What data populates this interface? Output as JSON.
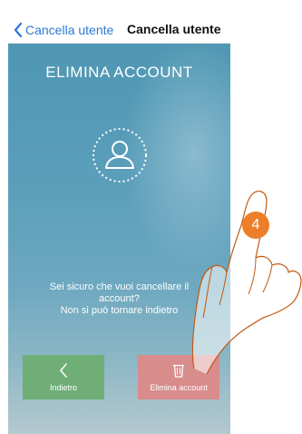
{
  "navbar": {
    "back_label": "Cancella utente",
    "title": "Cancella utente"
  },
  "screen": {
    "title": "ELIMINA ACCOUNT",
    "message_lines": [
      "Sei sicuro che vuoi cancellare il",
      "account?",
      "Non si può tornare indietro"
    ]
  },
  "buttons": {
    "back_label": "Indietro",
    "back_icon": "chevron-left-icon",
    "delete_label": "Elimina account",
    "delete_icon": "trash-icon"
  },
  "overlay": {
    "step_number": "4"
  },
  "colors": {
    "link": "#2b78d4",
    "back_button": "#6fae77",
    "delete_button": "#d88c8c",
    "step_badge": "#ee7f2a"
  }
}
